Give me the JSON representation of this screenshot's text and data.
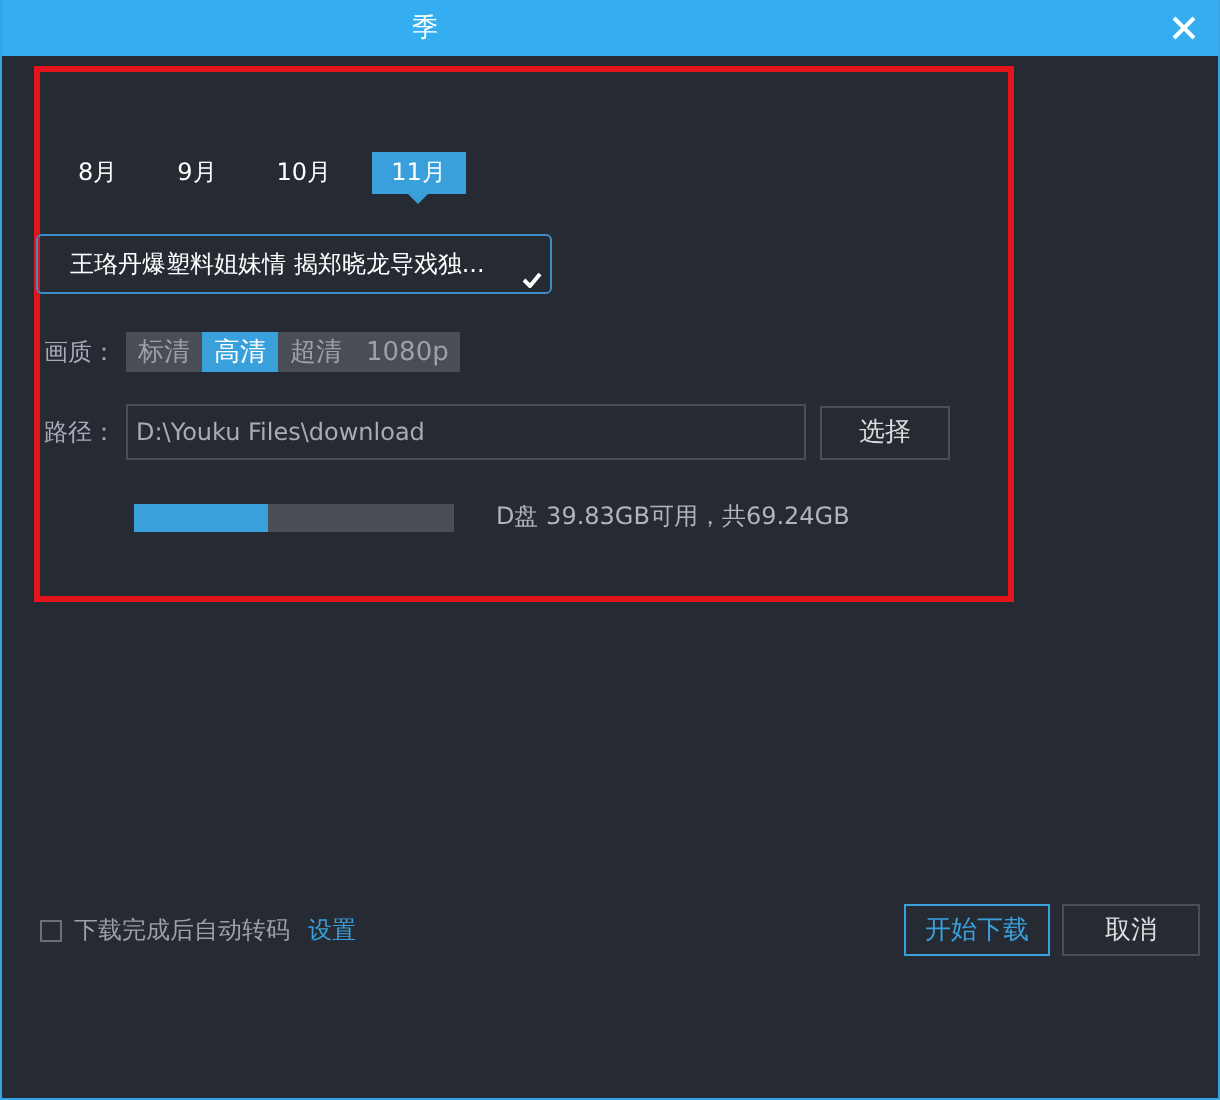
{
  "window": {
    "title": "季"
  },
  "months": [
    {
      "label": "8月",
      "selected": false
    },
    {
      "label": "9月",
      "selected": false
    },
    {
      "label": "10月",
      "selected": false
    },
    {
      "label": "11月",
      "selected": true
    }
  ],
  "episode_select": {
    "value": "王珞丹爆塑料姐妹情 揭郑晓龙导戏独..."
  },
  "quality": {
    "label": "画质：",
    "options": [
      {
        "label": "标清",
        "selected": false
      },
      {
        "label": "高清",
        "selected": true
      },
      {
        "label": "超清",
        "selected": false
      },
      {
        "label": "1080p",
        "selected": false
      }
    ]
  },
  "path": {
    "label": "路径：",
    "value": "D:\\Youku Files\\download",
    "button": "选择"
  },
  "disk": {
    "level": 0.42,
    "reading": "D盘 39.83GB可用，共69.24GB"
  },
  "auto_transcode": {
    "label": "下载完成后自动转码",
    "checked": false,
    "link": "设置"
  },
  "buttons": [
    {
      "label": "开始下载",
      "kind": "primary"
    },
    {
      "label": "取消",
      "kind": "secondary"
    }
  ]
}
